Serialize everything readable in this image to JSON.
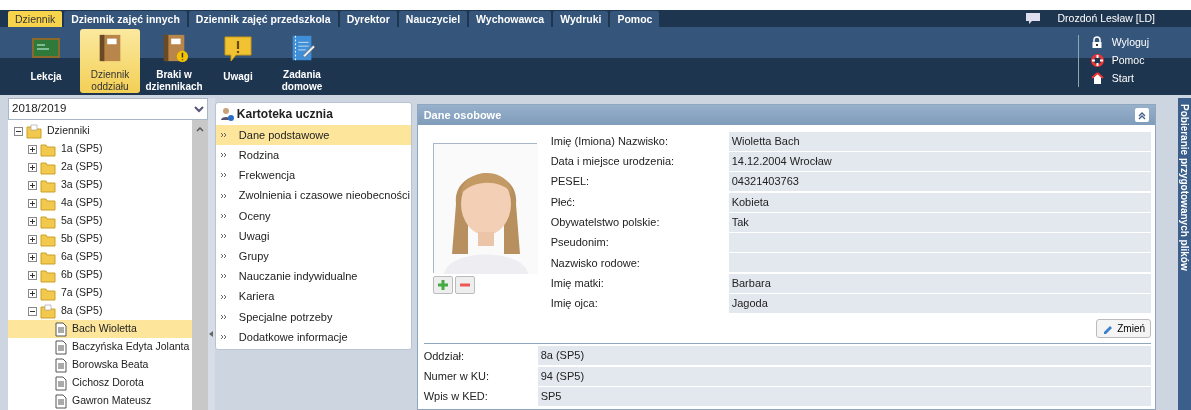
{
  "top_tabs": [
    {
      "label": "Dziennik",
      "selected": true
    },
    {
      "label": "Dziennik zajęć innych",
      "selected": false
    },
    {
      "label": "Dziennik zajęć przedszkola",
      "selected": false
    },
    {
      "label": "Dyrektor",
      "selected": false
    },
    {
      "label": "Nauczyciel",
      "selected": false
    },
    {
      "label": "Wychowawca",
      "selected": false
    },
    {
      "label": "Wydruki",
      "selected": false
    },
    {
      "label": "Pomoc",
      "selected": false
    }
  ],
  "user": {
    "name": "Drozdoń Lesław [LD]"
  },
  "toolbar": [
    {
      "label": "Lekcja",
      "kind": "board",
      "selected": false
    },
    {
      "label": "Dziennik oddziału",
      "kind": "book",
      "selected": true
    },
    {
      "label": "Braki w dziennikach",
      "kind": "bookwarn",
      "selected": false
    },
    {
      "label": "Uwagi",
      "kind": "note",
      "selected": false
    },
    {
      "label": "Zadania domowe",
      "kind": "pad",
      "selected": false
    }
  ],
  "links": [
    {
      "label": "Wyloguj",
      "kind": "lock"
    },
    {
      "label": "Pomoc",
      "kind": "buoy"
    },
    {
      "label": "Start",
      "kind": "home"
    }
  ],
  "year_select": {
    "value": "2018/2019"
  },
  "tree": {
    "label": "Dzienniki",
    "expanded": true,
    "selected": false,
    "children": [
      {
        "label": "1a (SP5)",
        "expanded": false,
        "selected": false
      },
      {
        "label": "2a (SP5)",
        "expanded": false,
        "selected": false
      },
      {
        "label": "3a (SP5)",
        "expanded": false,
        "selected": false
      },
      {
        "label": "4a (SP5)",
        "expanded": false,
        "selected": false
      },
      {
        "label": "5a (SP5)",
        "expanded": false,
        "selected": false
      },
      {
        "label": "5b (SP5)",
        "expanded": false,
        "selected": false
      },
      {
        "label": "6a (SP5)",
        "expanded": false,
        "selected": false
      },
      {
        "label": "6b (SP5)",
        "expanded": false,
        "selected": false
      },
      {
        "label": "7a (SP5)",
        "expanded": false,
        "selected": false
      },
      {
        "label": "8a (SP5)",
        "expanded": true,
        "selected": false,
        "children": [
          {
            "label": "Bach Wioletta",
            "selected": true
          },
          {
            "label": "Baczyńska Edyta Jolanta",
            "selected": false
          },
          {
            "label": "Borowska Beata",
            "selected": false
          },
          {
            "label": "Cichosz Dorota",
            "selected": false
          },
          {
            "label": "Gawron Mateusz",
            "selected": false
          }
        ]
      }
    ]
  },
  "student_menu": {
    "title": "Kartoteka ucznia",
    "items": [
      {
        "label": "Dane podstawowe",
        "selected": true
      },
      {
        "label": "Rodzina",
        "selected": false
      },
      {
        "label": "Frekwencja",
        "selected": false
      },
      {
        "label": "Zwolnienia i czasowe nieobecności",
        "selected": false
      },
      {
        "label": "Oceny",
        "selected": false
      },
      {
        "label": "Uwagi",
        "selected": false
      },
      {
        "label": "Grupy",
        "selected": false
      },
      {
        "label": "Nauczanie indywidualne",
        "selected": false
      },
      {
        "label": "Kariera",
        "selected": false
      },
      {
        "label": "Specjalne potrzeby",
        "selected": false
      },
      {
        "label": "Dodatkowe informacje",
        "selected": false
      }
    ]
  },
  "personal": {
    "title": "Dane osobowe",
    "fields": [
      {
        "label": "Imię (Imiona) Nazwisko:",
        "value": "Wioletta Bach"
      },
      {
        "label": "Data i miejsce urodzenia:",
        "value": "14.12.2004 Wrocław"
      },
      {
        "label": "PESEL:",
        "value": "04321403763"
      },
      {
        "label": "Płeć:",
        "value": "Kobieta"
      },
      {
        "label": "Obywatelstwo polskie:",
        "value": "Tak"
      },
      {
        "label": "Pseudonim:"
      },
      {
        "label": "Nazwisko rodowe:"
      },
      {
        "label": "Imię matki:",
        "value": "Barbara"
      },
      {
        "label": "Imię ojca:",
        "value": "Jagoda"
      }
    ],
    "edit_button": "Zmień"
  },
  "class_info": [
    {
      "label": "Oddział:",
      "value": "8a (SP5)"
    },
    {
      "label": "Numer w KU:",
      "value": "94 (SP5)"
    },
    {
      "label": "Wpis w KED:",
      "value": "SP5"
    }
  ],
  "side_tab": {
    "label": "Pobieranie przygotowanych plików"
  }
}
